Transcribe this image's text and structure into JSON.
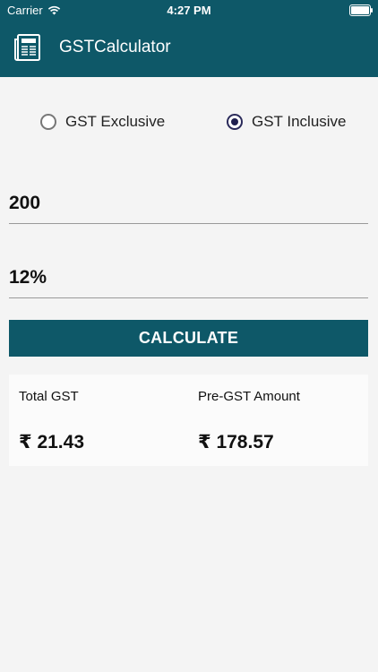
{
  "status_bar": {
    "carrier": "Carrier",
    "time": "4:27 PM"
  },
  "header": {
    "title": "GSTCalculator",
    "icon": "newspaper-icon",
    "color": "#0e5868"
  },
  "mode": {
    "options": [
      {
        "label": "GST Exclusive",
        "selected": false
      },
      {
        "label": "GST Inclusive",
        "selected": true
      }
    ]
  },
  "inputs": {
    "amount": "200",
    "rate": "12%"
  },
  "actions": {
    "calculate_label": "CALCULATE"
  },
  "results": {
    "total_gst_label": "Total GST",
    "total_gst_value": "₹ 21.43",
    "pre_gst_label": "Pre-GST Amount",
    "pre_gst_value": "₹ 178.57"
  }
}
